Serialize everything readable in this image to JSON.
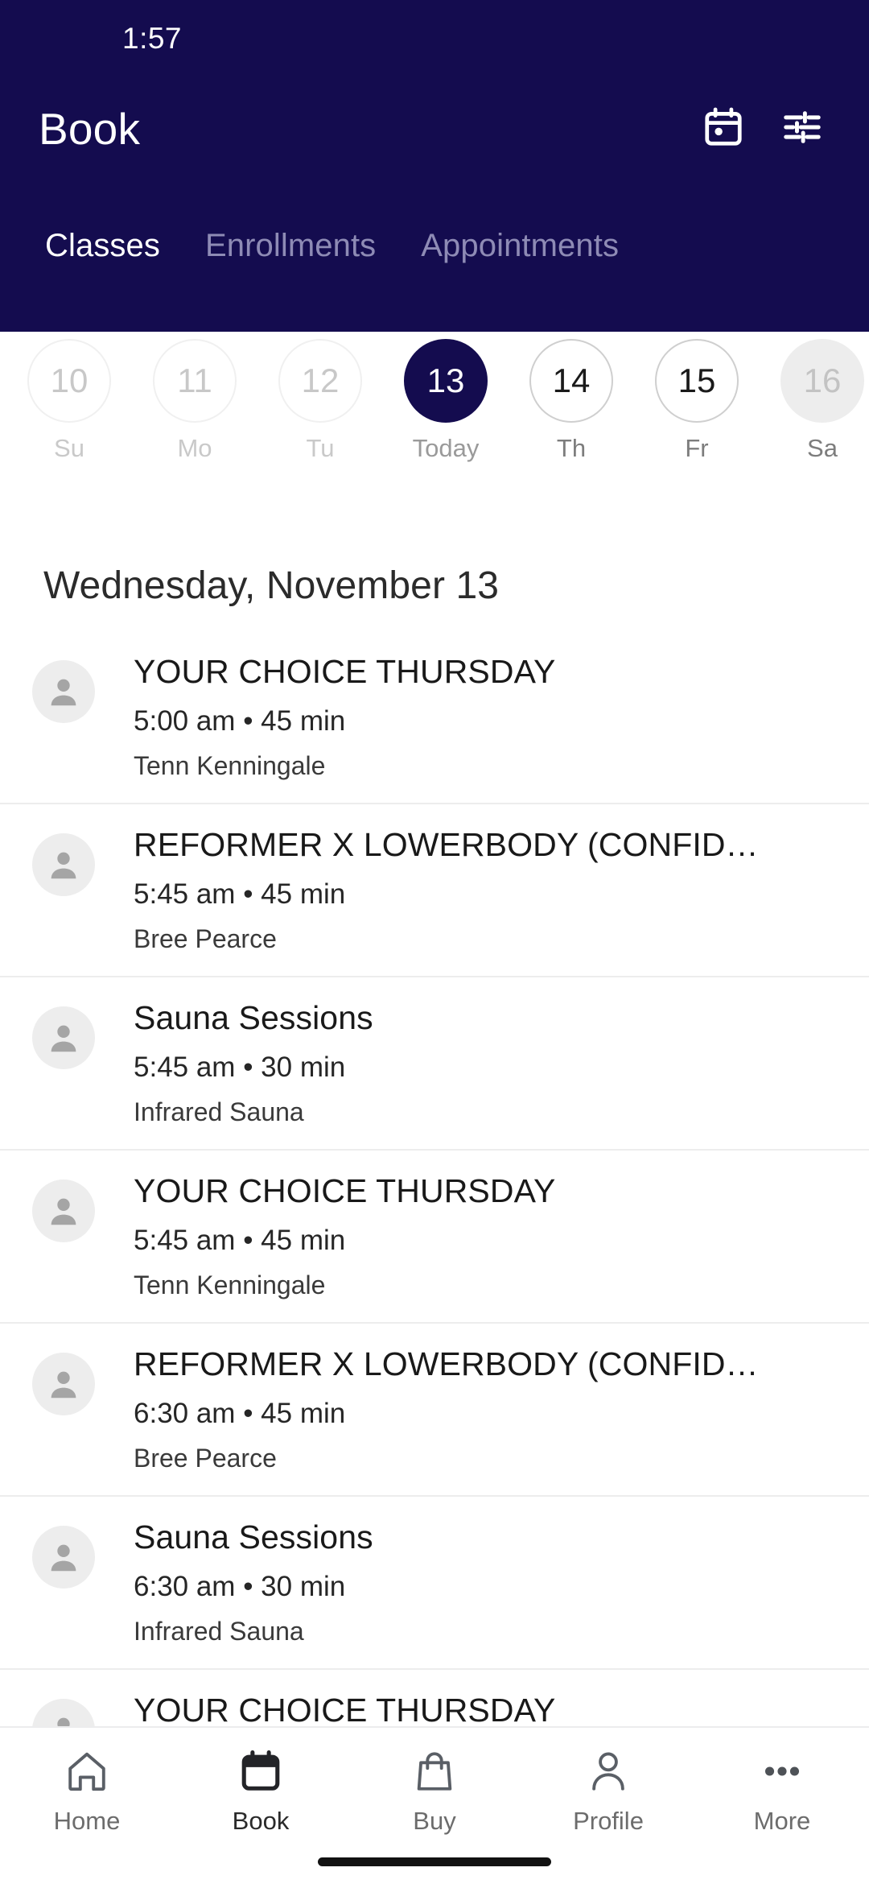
{
  "status_bar": {
    "time": "1:57"
  },
  "header": {
    "title": "Book",
    "calendar_icon": "calendar-icon",
    "filter_icon": "filter-sliders-icon",
    "background_color": "#140c4f",
    "tabs": [
      {
        "label": "Classes",
        "active": true
      },
      {
        "label": "Enrollments",
        "active": false
      },
      {
        "label": "Appointments",
        "active": false
      }
    ]
  },
  "date_strip": {
    "days": [
      {
        "day_number": "10",
        "day_label": "Su",
        "state": "past"
      },
      {
        "day_number": "11",
        "day_label": "Mo",
        "state": "past"
      },
      {
        "day_number": "12",
        "day_label": "Tu",
        "state": "past"
      },
      {
        "day_number": "13",
        "day_label": "Today",
        "state": "selected"
      },
      {
        "day_number": "14",
        "day_label": "Th",
        "state": "available"
      },
      {
        "day_number": "15",
        "day_label": "Fr",
        "state": "available"
      },
      {
        "day_number": "16",
        "day_label": "Sa",
        "state": "disabled"
      }
    ]
  },
  "main": {
    "date_heading": "Wednesday, November 13",
    "classes": [
      {
        "name": "YOUR CHOICE THURSDAY",
        "time": "5:00 am • 45 min",
        "staff": "Tenn Kenningale"
      },
      {
        "name": "REFORMER X LOWERBODY (CONFID…",
        "time": "5:45 am • 45 min",
        "staff": "Bree Pearce"
      },
      {
        "name": "Sauna Sessions",
        "time": "5:45 am • 30 min",
        "staff": "Infrared Sauna"
      },
      {
        "name": "YOUR CHOICE THURSDAY",
        "time": "5:45 am • 45 min",
        "staff": "Tenn Kenningale"
      },
      {
        "name": "REFORMER X LOWERBODY (CONFID…",
        "time": "6:30 am • 45 min",
        "staff": "Bree Pearce"
      },
      {
        "name": "Sauna Sessions",
        "time": "6:30 am • 30 min",
        "staff": "Infrared Sauna"
      },
      {
        "name": "YOUR CHOICE THURSDAY",
        "time": "",
        "staff": ""
      }
    ]
  },
  "bottom_nav": {
    "items": [
      {
        "label": "Home",
        "icon": "home-icon",
        "active": false
      },
      {
        "label": "Book",
        "icon": "calendar-icon",
        "active": true
      },
      {
        "label": "Buy",
        "icon": "shopping-bag-icon",
        "active": false
      },
      {
        "label": "Profile",
        "icon": "person-icon",
        "active": false
      },
      {
        "label": "More",
        "icon": "more-dots-icon",
        "active": false
      }
    ]
  }
}
